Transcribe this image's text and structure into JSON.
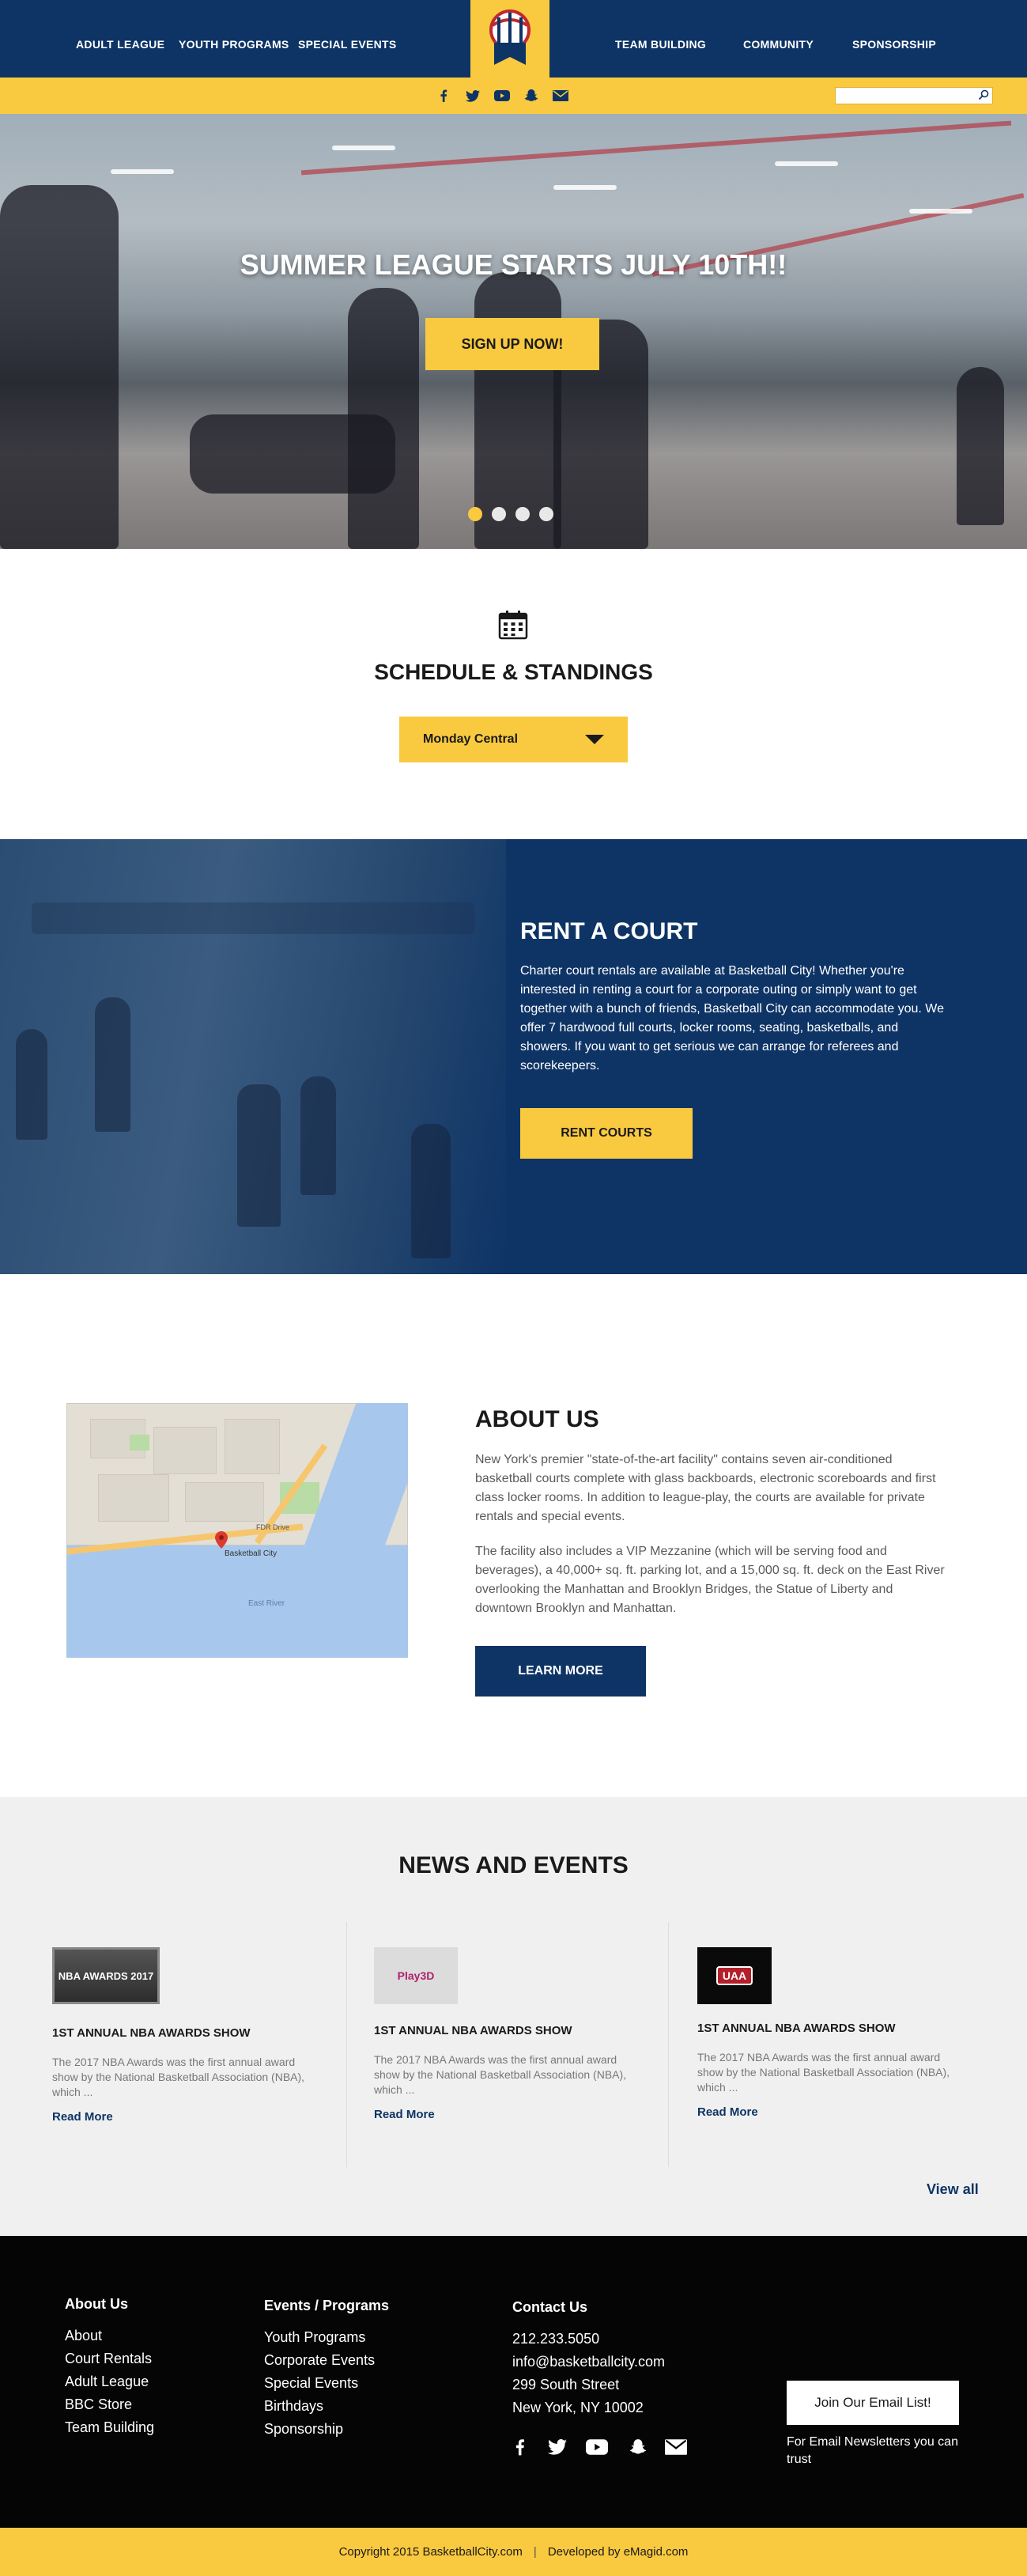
{
  "colors": {
    "navy": "#0e3466",
    "yellow": "#f9c93f",
    "black": "#050505",
    "news_bg": "#f0f0f0"
  },
  "nav": {
    "left": [
      "Adult League",
      "Youth Programs",
      "Special Events"
    ],
    "right": [
      "Team Building",
      "Community",
      "Sponsorship"
    ],
    "logo": "basketball-city-logo"
  },
  "utility": {
    "social_icons": [
      "facebook-icon",
      "twitter-icon",
      "youtube-icon",
      "snapchat-icon",
      "mail-icon"
    ],
    "search_placeholder": ""
  },
  "hero": {
    "title": "SUMMER LEAGUE STARTS JULY 10TH!!",
    "button": "SIGN UP NOW!",
    "slides": 4,
    "active_slide": 1
  },
  "schedule": {
    "title": "SCHEDULE & STANDINGS",
    "selected": "Monday Central"
  },
  "rent": {
    "title": "RENT A COURT",
    "body": "Charter court rentals are available at Basketball City! Whether you're interested in renting a court for a corporate outing or simply want to get together with a bunch of friends, Basketball City can accommodate you. We offer 7 hardwood full courts, locker rooms, seating, basketballs, and showers. If you want to get serious we can arrange for referees and scorekeepers.",
    "button": "RENT COURTS"
  },
  "about": {
    "title": "ABOUT US",
    "p1": "New York's premier \"state-of-the-art facility\" contains seven air-conditioned basketball courts complete with glass backboards, electronic scoreboards and first class locker rooms. In addition to league-play, the courts are available for private rentals and special events.",
    "p2": "The facility also includes a VIP Mezzanine (which will be serving food and beverages), a 40,000+ sq. ft. parking lot, and a 15,000 sq. ft. deck on the East River overlooking the Manhattan and Brooklyn Bridges, the Statue of Liberty and downtown Brooklyn and Manhattan.",
    "button": "LEARN MORE",
    "map_labels": [
      "Basketball City",
      "FDR Drive",
      "East River"
    ]
  },
  "news": {
    "title": "NEWS AND EVENTS",
    "items": [
      {
        "thumb": "NBA AWARDS 2017",
        "title": "1ST ANNUAL NBA AWARDS SHOW",
        "text": "The 2017 NBA Awards was the first annual award show by the National Basketball Association (NBA), which ...",
        "more": "Read More"
      },
      {
        "thumb": "Play3D",
        "title": "1ST ANNUAL NBA AWARDS SHOW",
        "text": "The 2017 NBA Awards was the first annual award show by the National Basketball Association (NBA), which ...",
        "more": "Read More"
      },
      {
        "thumb": "UAA",
        "title": "1ST ANNUAL NBA AWARDS SHOW",
        "text": "The 2017 NBA Awards was the first annual award show by the National Basketball Association (NBA), which ...",
        "more": "Read More"
      }
    ],
    "view_all": "View all"
  },
  "footer": {
    "about": {
      "title": "About Us",
      "links": [
        "About",
        "Court Rentals",
        "Adult League",
        "BBC Store",
        "Team Building"
      ]
    },
    "events": {
      "title": "Events / Programs",
      "links": [
        "Youth Programs",
        "Corporate Events",
        "Special Events",
        "Birthdays",
        "Sponsorship"
      ]
    },
    "contact": {
      "title": "Contact Us",
      "lines": [
        "212.233.5050",
        "info@basketballcity.com",
        "299 South Street",
        "New York, NY 10002"
      ]
    },
    "social_icons": [
      "facebook-icon",
      "twitter-icon",
      "youtube-icon",
      "snapchat-icon",
      "mail-icon"
    ],
    "email_button": "Join Our Email List!",
    "email_note": "For Email Newsletters you can trust"
  },
  "bottombar": {
    "copyright": "Copyright 2015 BasketballCity.com",
    "separator": "|",
    "developer": "Developed by eMagid.com"
  }
}
